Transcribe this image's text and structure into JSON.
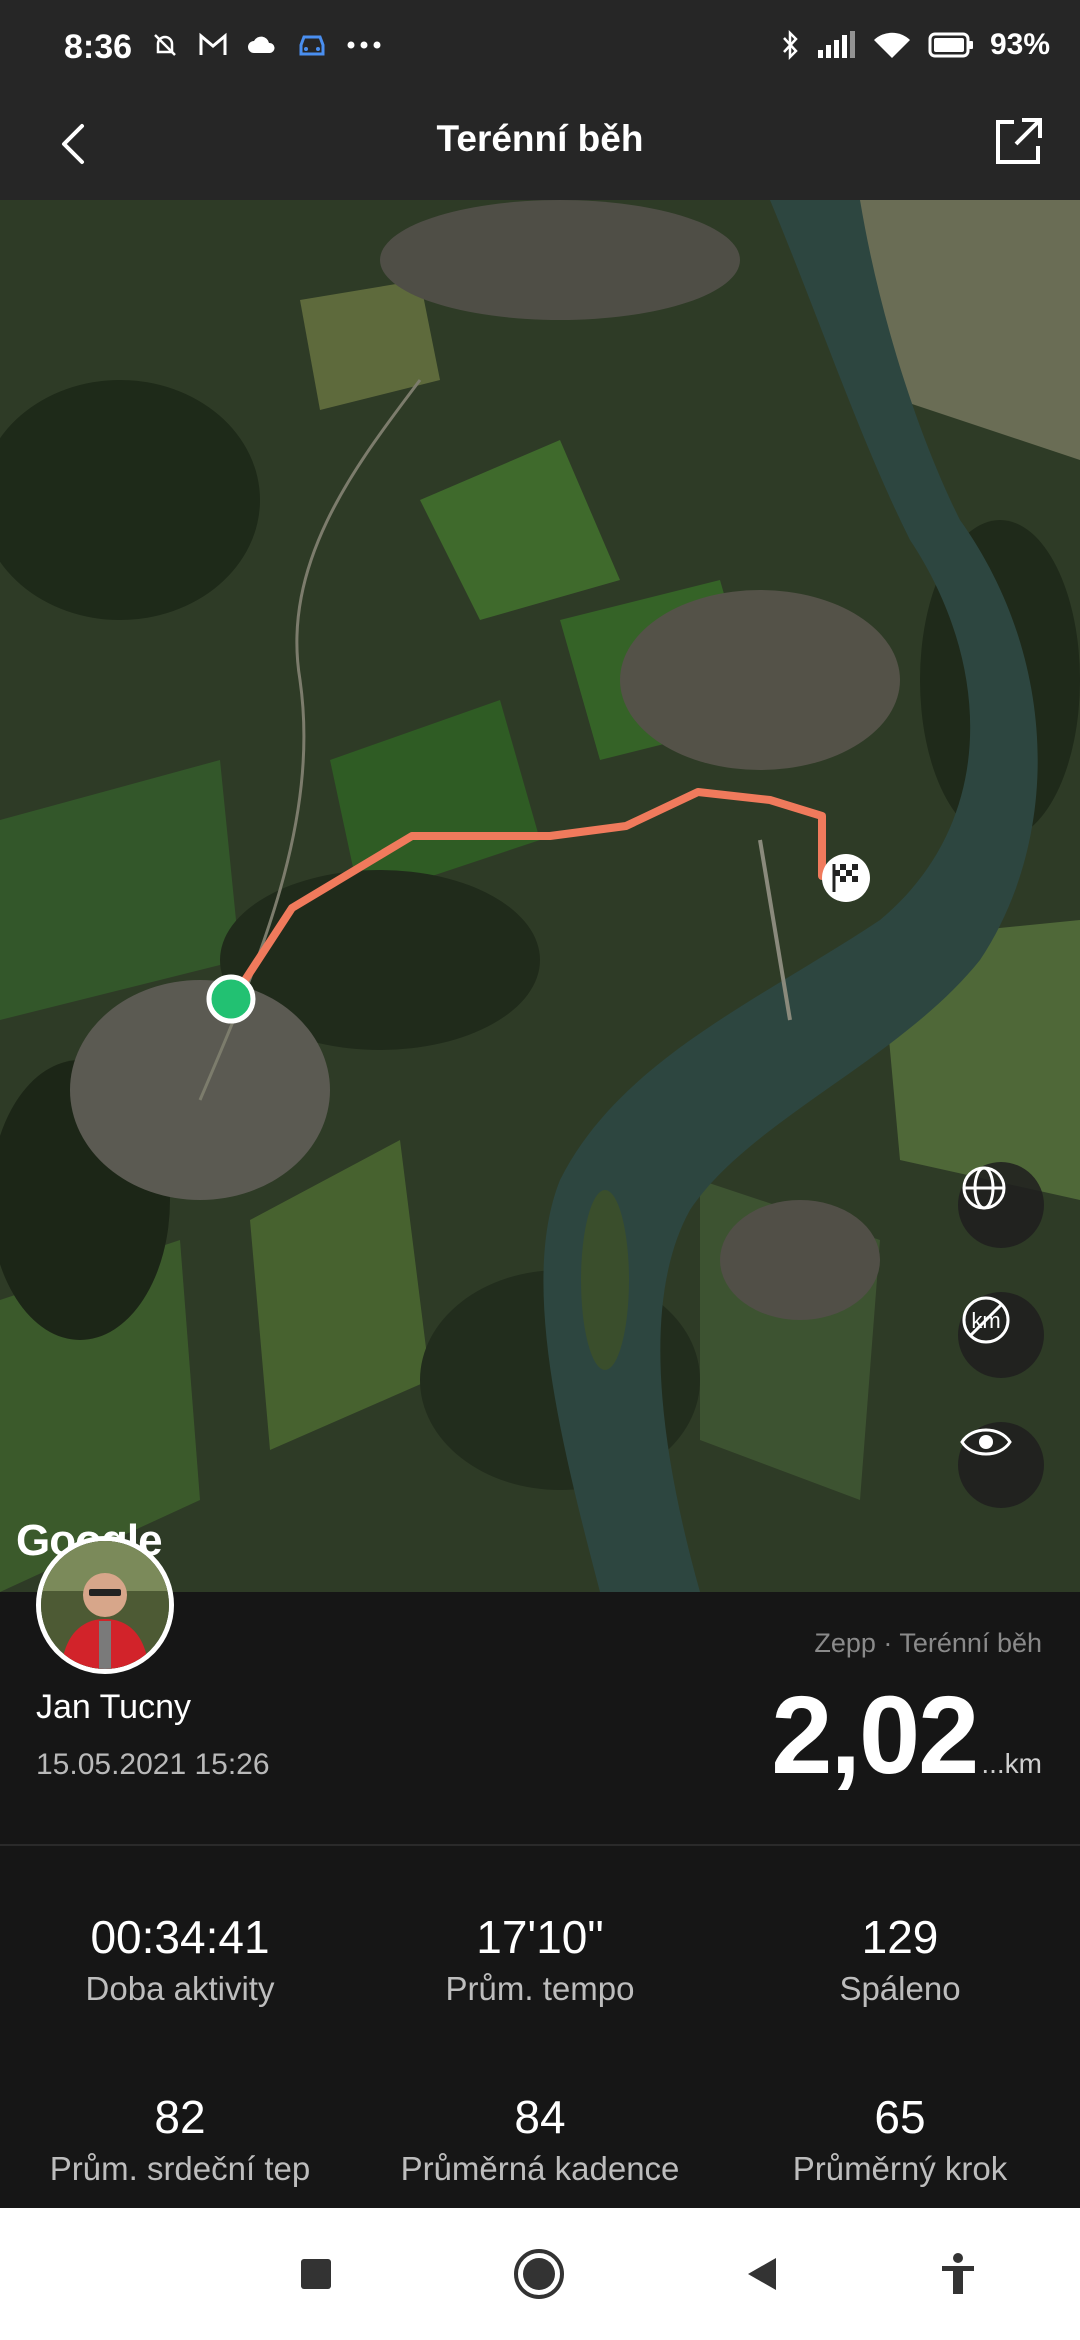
{
  "status_bar": {
    "time": "8:36",
    "battery": "93%",
    "icons_left": [
      "mute-icon",
      "gmail-icon",
      "cloud-icon",
      "car-icon",
      "more-icon"
    ],
    "icons_right": [
      "bluetooth-icon",
      "signal-icon",
      "wifi-icon",
      "battery-icon"
    ]
  },
  "header": {
    "title": "Terénní běh"
  },
  "map": {
    "route_color": "#f07a5c",
    "start_color": "#22c172",
    "provider_logo": "Google",
    "controls": [
      "globe-icon",
      "km-off-icon",
      "eye-icon"
    ]
  },
  "profile": {
    "name": "Jan Tucny",
    "date": "15.05.2021 15:26"
  },
  "summary": {
    "source": "Zepp · Terénní běh",
    "distance": "2,02",
    "unit": "...km"
  },
  "stats": [
    {
      "value": "00:34:41",
      "label": "Doba aktivity"
    },
    {
      "value": "17'10\"",
      "label": "Prům. tempo"
    },
    {
      "value": "129",
      "label": "Spáleno"
    },
    {
      "value": "82",
      "label": "Prům. srdeční tep"
    },
    {
      "value": "84",
      "label": "Průměrná kadence"
    },
    {
      "value": "65",
      "label": "Průměrný krok"
    }
  ],
  "nav": [
    "recents-icon",
    "home-icon",
    "back-icon",
    "accessibility-icon"
  ]
}
